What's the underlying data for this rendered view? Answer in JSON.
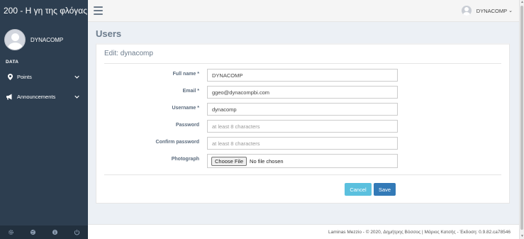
{
  "app": {
    "title": "200 - Η γη της φλόγας"
  },
  "sidebar": {
    "user_name": "DYNACOMP",
    "section_header": "DATA",
    "items": [
      {
        "label": "Points",
        "icon": "map-marker-icon"
      },
      {
        "label": "Announcements",
        "icon": "bullhorn-icon"
      }
    ],
    "footer_icons": [
      "gear-icon",
      "globe-icon",
      "info-icon",
      "power-icon"
    ]
  },
  "topbar": {
    "user_name": "DYNACOMP",
    "caret": "⌄"
  },
  "page": {
    "title": "Users",
    "box_title": "Edit: dynacomp",
    "fields": {
      "full_name": {
        "label": "Full name *",
        "value": "DYNACOMP"
      },
      "email": {
        "label": "Email *",
        "value": "ggeo@dynacompbi.com"
      },
      "username": {
        "label": "Username *",
        "value": "dynacomp"
      },
      "password": {
        "label": "Password",
        "placeholder": "at least 8 characters"
      },
      "confirm_password": {
        "label": "Confirm password",
        "placeholder": "at least 8 characters"
      },
      "photograph": {
        "label": "Photograph",
        "button": "Choose File",
        "status": "No file chosen"
      }
    },
    "buttons": {
      "cancel": "Cancel",
      "save": "Save"
    }
  },
  "footer": {
    "text": "Laminas Mezzio - © 2020, Δημήτρης Βόσσος | Μάριος Κατσής - Έκδοση: 0.9.82.ca78546"
  },
  "colors": {
    "sidebar": "#2d3e50",
    "cancel": "#5bc0de",
    "save": "#337ab7"
  }
}
